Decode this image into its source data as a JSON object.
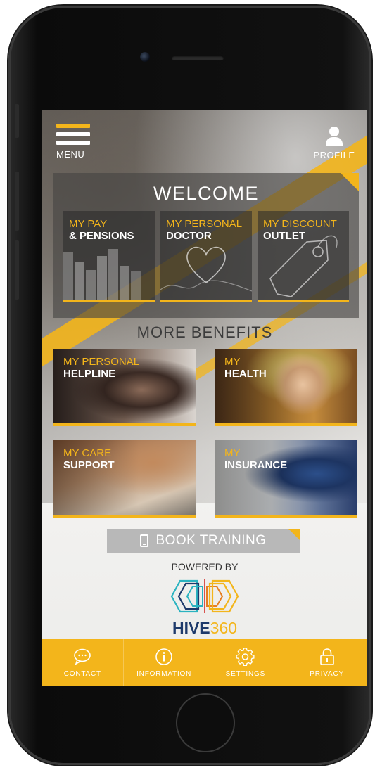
{
  "header": {
    "menu_label": "MENU",
    "profile_label": "PROFILE"
  },
  "welcome": {
    "title": "WELCOME",
    "tiles": [
      {
        "line1": "MY PAY",
        "line2": "& PENSIONS",
        "icon": "bar-chart-icon"
      },
      {
        "line1": "MY PERSONAL",
        "line2": "DOCTOR",
        "icon": "heart-icon"
      },
      {
        "line1": "MY DISCOUNT",
        "line2": "OUTLET",
        "icon": "price-tag-icon"
      }
    ]
  },
  "more_benefits": {
    "title": "MORE BENEFITS",
    "cards": [
      {
        "line1": "MY PERSONAL",
        "line2": "HELPLINE"
      },
      {
        "line1": "MY",
        "line2": "HEALTH"
      },
      {
        "line1": "MY CARE",
        "line2": "SUPPORT"
      },
      {
        "line1": "MY",
        "line2": "INSURANCE"
      }
    ]
  },
  "book_training": {
    "label": "BOOK TRAINING",
    "icon": "mobile-phone-icon"
  },
  "brand": {
    "powered_by": "POWERED BY",
    "name_part1": "HIVE",
    "name_part2": "360"
  },
  "bottom_nav": [
    {
      "label": "CONTACT",
      "icon": "chat-bubble-icon"
    },
    {
      "label": "INFORMATION",
      "icon": "info-icon"
    },
    {
      "label": "SETTINGS",
      "icon": "gear-icon"
    },
    {
      "label": "PRIVACY",
      "icon": "lock-icon"
    }
  ],
  "colors": {
    "accent": "#f3b51b",
    "brand_navy": "#1e3a6b",
    "nav_background": "#f3b51b"
  }
}
